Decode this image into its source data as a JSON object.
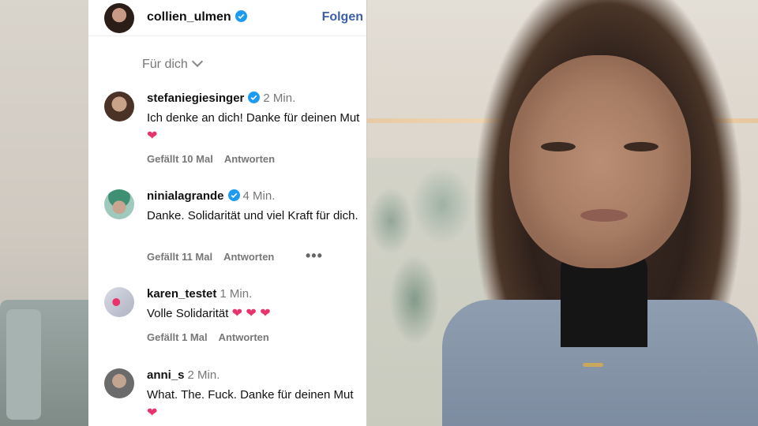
{
  "header": {
    "username": "collien_ulmen",
    "follow_label": "Folgen",
    "avatar_icon": "profile-avatar"
  },
  "filter": {
    "label": "Für dich"
  },
  "comments": [
    {
      "username": "stefaniegiesinger",
      "verified": true,
      "time": "2 Min.",
      "text": "Ich denke an dich! Danke für deinen Mut",
      "hearts": "❤",
      "likes": "Gefällt 10 Mal",
      "reply": "Antworten"
    },
    {
      "username": "ninialagrande",
      "verified": true,
      "time": "4 Min.",
      "text": "Danke. Solidarität und viel Kraft für dich.",
      "likes": "Gefällt 11 Mal",
      "reply": "Antworten",
      "more": "•••"
    },
    {
      "username": "karen_testet",
      "verified": false,
      "time": "1 Min.",
      "text": "Volle Solidarität",
      "hearts": "❤ ❤ ❤",
      "likes": "Gefällt 1 Mal",
      "reply": "Antworten"
    },
    {
      "username": "anni_s",
      "verified": false,
      "time": "2 Min.",
      "text": "What. The. Fuck. Danke für deinen Mut",
      "hearts": "❤"
    }
  ],
  "colors": {
    "accent": "#3c5fa8",
    "verified": "#1d9bf0",
    "heart": "#e8336b",
    "muted": "#777777"
  }
}
